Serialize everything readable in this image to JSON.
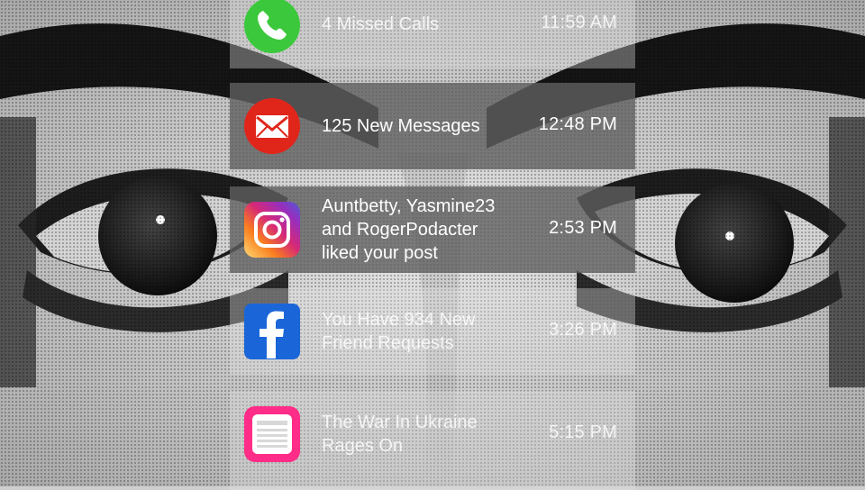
{
  "notifications": [
    {
      "app": "phone",
      "icon": "phone-icon",
      "message": "4 Missed Calls",
      "time": "11:59 AM",
      "color": "#3cc83c"
    },
    {
      "app": "mail",
      "icon": "mail-icon",
      "message": "125 New Messages",
      "time": "12:48 PM",
      "color": "#e0261b"
    },
    {
      "app": "instagram",
      "icon": "instagram-icon",
      "message": "Auntbetty, Yasmine23\nand RogerPodacter\nliked your post",
      "time": "2:53 PM",
      "color": "#c13584"
    },
    {
      "app": "facebook",
      "icon": "facebook-icon",
      "message": "You Have 934 New\nFriend Requests",
      "time": "3:26 PM",
      "color": "#1a66d8"
    },
    {
      "app": "news",
      "icon": "news-icon",
      "message": "The War In Ukraine\nRages On",
      "time": "5:15 PM",
      "color": "#ff2d87"
    }
  ],
  "colors": {
    "card_dark": "#5f5f5f",
    "card_light": "#e1e1e1",
    "text": "#ffffff",
    "background_dark": "#111111",
    "background_light": "#d9d9d9"
  }
}
